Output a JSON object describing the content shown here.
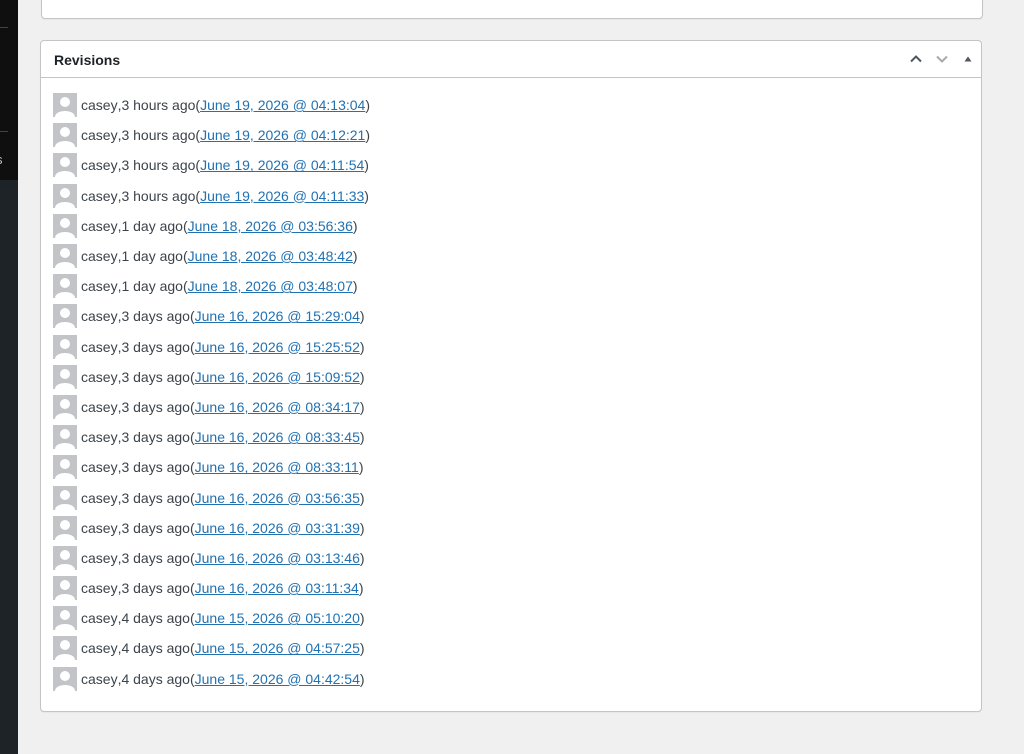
{
  "revisions_box": {
    "title": "Revisions",
    "items": [
      {
        "author": "casey",
        "ago": "3 hours ago",
        "date": "June 19, 2026 @ 04:13:04"
      },
      {
        "author": "casey",
        "ago": "3 hours ago",
        "date": "June 19, 2026 @ 04:12:21"
      },
      {
        "author": "casey",
        "ago": "3 hours ago",
        "date": "June 19, 2026 @ 04:11:54"
      },
      {
        "author": "casey",
        "ago": "3 hours ago",
        "date": "June 19, 2026 @ 04:11:33"
      },
      {
        "author": "casey",
        "ago": "1 day ago",
        "date": "June 18, 2026 @ 03:56:36"
      },
      {
        "author": "casey",
        "ago": "1 day ago",
        "date": "June 18, 2026 @ 03:48:42"
      },
      {
        "author": "casey",
        "ago": "1 day ago",
        "date": "June 18, 2026 @ 03:48:07"
      },
      {
        "author": "casey",
        "ago": "3 days ago",
        "date": "June 16, 2026 @ 15:29:04"
      },
      {
        "author": "casey",
        "ago": "3 days ago",
        "date": "June 16, 2026 @ 15:25:52"
      },
      {
        "author": "casey",
        "ago": "3 days ago",
        "date": "June 16, 2026 @ 15:09:52"
      },
      {
        "author": "casey",
        "ago": "3 days ago",
        "date": "June 16, 2026 @ 08:34:17"
      },
      {
        "author": "casey",
        "ago": "3 days ago",
        "date": "June 16, 2026 @ 08:33:45"
      },
      {
        "author": "casey",
        "ago": "3 days ago",
        "date": "June 16, 2026 @ 08:33:11"
      },
      {
        "author": "casey",
        "ago": "3 days ago",
        "date": "June 16, 2026 @ 03:56:35"
      },
      {
        "author": "casey",
        "ago": "3 days ago",
        "date": "June 16, 2026 @ 03:31:39"
      },
      {
        "author": "casey",
        "ago": "3 days ago",
        "date": "June 16, 2026 @ 03:13:46"
      },
      {
        "author": "casey",
        "ago": "3 days ago",
        "date": "June 16, 2026 @ 03:11:34"
      },
      {
        "author": "casey",
        "ago": "4 days ago",
        "date": "June 15, 2026 @ 05:10:20"
      },
      {
        "author": "casey",
        "ago": "4 days ago",
        "date": "June 15, 2026 @ 04:57:25"
      },
      {
        "author": "casey",
        "ago": "4 days ago",
        "date": "June 15, 2026 @ 04:42:54"
      }
    ],
    "controls": {
      "move_up_icon": "chevron-up-icon",
      "move_down_icon": "chevron-down-icon",
      "toggle_icon": "triangle-up-icon"
    }
  },
  "sidebar": {
    "cut_label": "s"
  },
  "colors": {
    "link": "#2271b1",
    "text": "#3c434a",
    "border": "#c3c4c7",
    "background": "#f0f0f1",
    "sidebar": "#1d2327",
    "avatar": "#c3c4c7"
  }
}
